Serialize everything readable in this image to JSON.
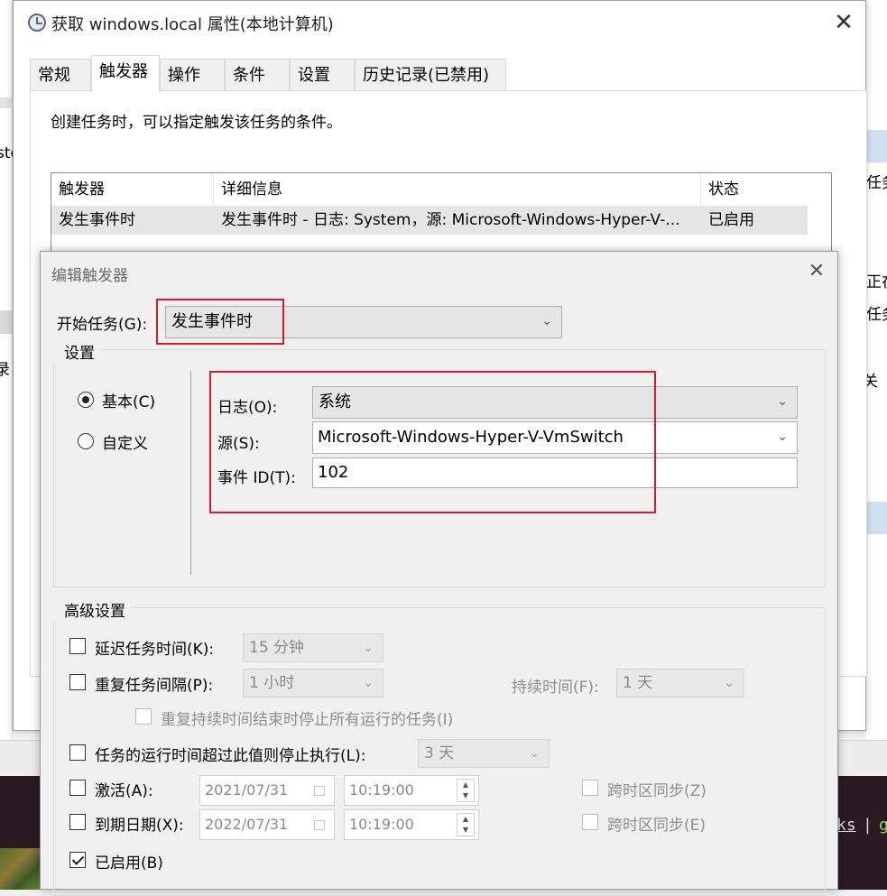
{
  "background": {
    "left_snippets": [
      "ste",
      "录"
    ],
    "right_snippets": [
      "任务",
      "正在",
      "任务",
      "关"
    ],
    "terminal": {
      "link_text": "ks",
      "separator": "|",
      "green_text": "g"
    }
  },
  "props_window": {
    "title": "获取 windows.local 属性(本地计算机)",
    "close_glyph": "✕",
    "tabs": [
      "常规",
      "触发器",
      "操作",
      "条件",
      "设置",
      "历史记录(已禁用)"
    ],
    "active_tab": "触发器",
    "hint": "创建任务时，可以指定触发该任务的条件。",
    "list": {
      "columns": [
        "触发器",
        "详细信息",
        "状态"
      ],
      "rows": [
        {
          "trigger": "发生事件时",
          "detail": "发生事件时 - 日志: System，源: Microsoft-Windows-Hyper-V-...",
          "status": "已启用"
        }
      ]
    }
  },
  "edit_dialog": {
    "title": "编辑触发器",
    "close_glyph": "✕",
    "start_task_label": "开始任务(G):",
    "start_task_value": "发生事件时",
    "settings_title": "设置",
    "radio_basic": "基本(C)",
    "radio_custom": "自定义",
    "selected_radio": "basic",
    "log_label": "日志(O):",
    "log_value": "系统",
    "source_label": "源(S):",
    "source_value": "Microsoft-Windows-Hyper-V-VmSwitch",
    "event_id_label": "事件 ID(T):",
    "event_id_value": "102",
    "advanced_title": "高级设置",
    "delay_label": "延迟任务时间(K):",
    "delay_value": "15 分钟",
    "delay_checked": false,
    "repeat_label": "重复任务间隔(P):",
    "repeat_value": "1 小时",
    "repeat_checked": false,
    "duration_label": "持续时间(F):",
    "duration_value": "1 天",
    "stop_all_label": "重复持续时间结束时停止所有运行的任务(I)",
    "stop_if_label": "任务的运行时间超过此值则停止执行(L):",
    "stop_if_value": "3 天",
    "stop_if_checked": false,
    "activate_label": "激活(A):",
    "activate_date": "2021/07/31",
    "activate_time": "10:19:00",
    "activate_checked": false,
    "expire_label": "到期日期(X):",
    "expire_date": "2022/07/31",
    "expire_time": "10:19:00",
    "expire_checked": false,
    "sync_tz_z": "跨时区同步(Z)",
    "sync_tz_e": "跨时区同步(E)",
    "enabled_label": "已启用(B)",
    "enabled_checked": true
  },
  "colors": {
    "highlight_box": "#d21f2b",
    "selection_band": "#cfe0f1"
  }
}
